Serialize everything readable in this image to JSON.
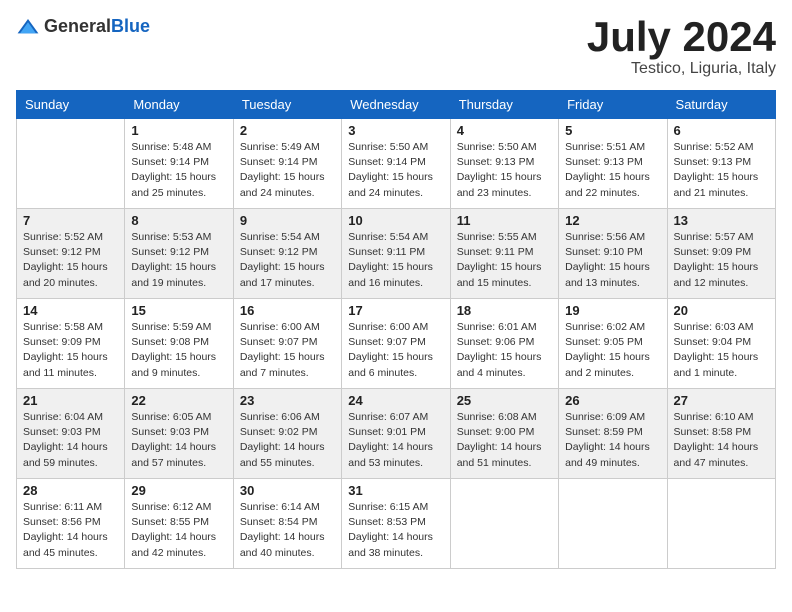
{
  "header": {
    "logo_general": "General",
    "logo_blue": "Blue",
    "month": "July 2024",
    "location": "Testico, Liguria, Italy"
  },
  "weekdays": [
    "Sunday",
    "Monday",
    "Tuesday",
    "Wednesday",
    "Thursday",
    "Friday",
    "Saturday"
  ],
  "weeks": [
    [
      {
        "day": "",
        "sunrise": "",
        "sunset": "",
        "daylight": ""
      },
      {
        "day": "1",
        "sunrise": "Sunrise: 5:48 AM",
        "sunset": "Sunset: 9:14 PM",
        "daylight": "Daylight: 15 hours and 25 minutes."
      },
      {
        "day": "2",
        "sunrise": "Sunrise: 5:49 AM",
        "sunset": "Sunset: 9:14 PM",
        "daylight": "Daylight: 15 hours and 24 minutes."
      },
      {
        "day": "3",
        "sunrise": "Sunrise: 5:50 AM",
        "sunset": "Sunset: 9:14 PM",
        "daylight": "Daylight: 15 hours and 24 minutes."
      },
      {
        "day": "4",
        "sunrise": "Sunrise: 5:50 AM",
        "sunset": "Sunset: 9:13 PM",
        "daylight": "Daylight: 15 hours and 23 minutes."
      },
      {
        "day": "5",
        "sunrise": "Sunrise: 5:51 AM",
        "sunset": "Sunset: 9:13 PM",
        "daylight": "Daylight: 15 hours and 22 minutes."
      },
      {
        "day": "6",
        "sunrise": "Sunrise: 5:52 AM",
        "sunset": "Sunset: 9:13 PM",
        "daylight": "Daylight: 15 hours and 21 minutes."
      }
    ],
    [
      {
        "day": "7",
        "sunrise": "Sunrise: 5:52 AM",
        "sunset": "Sunset: 9:12 PM",
        "daylight": "Daylight: 15 hours and 20 minutes."
      },
      {
        "day": "8",
        "sunrise": "Sunrise: 5:53 AM",
        "sunset": "Sunset: 9:12 PM",
        "daylight": "Daylight: 15 hours and 19 minutes."
      },
      {
        "day": "9",
        "sunrise": "Sunrise: 5:54 AM",
        "sunset": "Sunset: 9:12 PM",
        "daylight": "Daylight: 15 hours and 17 minutes."
      },
      {
        "day": "10",
        "sunrise": "Sunrise: 5:54 AM",
        "sunset": "Sunset: 9:11 PM",
        "daylight": "Daylight: 15 hours and 16 minutes."
      },
      {
        "day": "11",
        "sunrise": "Sunrise: 5:55 AM",
        "sunset": "Sunset: 9:11 PM",
        "daylight": "Daylight: 15 hours and 15 minutes."
      },
      {
        "day": "12",
        "sunrise": "Sunrise: 5:56 AM",
        "sunset": "Sunset: 9:10 PM",
        "daylight": "Daylight: 15 hours and 13 minutes."
      },
      {
        "day": "13",
        "sunrise": "Sunrise: 5:57 AM",
        "sunset": "Sunset: 9:09 PM",
        "daylight": "Daylight: 15 hours and 12 minutes."
      }
    ],
    [
      {
        "day": "14",
        "sunrise": "Sunrise: 5:58 AM",
        "sunset": "Sunset: 9:09 PM",
        "daylight": "Daylight: 15 hours and 11 minutes."
      },
      {
        "day": "15",
        "sunrise": "Sunrise: 5:59 AM",
        "sunset": "Sunset: 9:08 PM",
        "daylight": "Daylight: 15 hours and 9 minutes."
      },
      {
        "day": "16",
        "sunrise": "Sunrise: 6:00 AM",
        "sunset": "Sunset: 9:07 PM",
        "daylight": "Daylight: 15 hours and 7 minutes."
      },
      {
        "day": "17",
        "sunrise": "Sunrise: 6:00 AM",
        "sunset": "Sunset: 9:07 PM",
        "daylight": "Daylight: 15 hours and 6 minutes."
      },
      {
        "day": "18",
        "sunrise": "Sunrise: 6:01 AM",
        "sunset": "Sunset: 9:06 PM",
        "daylight": "Daylight: 15 hours and 4 minutes."
      },
      {
        "day": "19",
        "sunrise": "Sunrise: 6:02 AM",
        "sunset": "Sunset: 9:05 PM",
        "daylight": "Daylight: 15 hours and 2 minutes."
      },
      {
        "day": "20",
        "sunrise": "Sunrise: 6:03 AM",
        "sunset": "Sunset: 9:04 PM",
        "daylight": "Daylight: 15 hours and 1 minute."
      }
    ],
    [
      {
        "day": "21",
        "sunrise": "Sunrise: 6:04 AM",
        "sunset": "Sunset: 9:03 PM",
        "daylight": "Daylight: 14 hours and 59 minutes."
      },
      {
        "day": "22",
        "sunrise": "Sunrise: 6:05 AM",
        "sunset": "Sunset: 9:03 PM",
        "daylight": "Daylight: 14 hours and 57 minutes."
      },
      {
        "day": "23",
        "sunrise": "Sunrise: 6:06 AM",
        "sunset": "Sunset: 9:02 PM",
        "daylight": "Daylight: 14 hours and 55 minutes."
      },
      {
        "day": "24",
        "sunrise": "Sunrise: 6:07 AM",
        "sunset": "Sunset: 9:01 PM",
        "daylight": "Daylight: 14 hours and 53 minutes."
      },
      {
        "day": "25",
        "sunrise": "Sunrise: 6:08 AM",
        "sunset": "Sunset: 9:00 PM",
        "daylight": "Daylight: 14 hours and 51 minutes."
      },
      {
        "day": "26",
        "sunrise": "Sunrise: 6:09 AM",
        "sunset": "Sunset: 8:59 PM",
        "daylight": "Daylight: 14 hours and 49 minutes."
      },
      {
        "day": "27",
        "sunrise": "Sunrise: 6:10 AM",
        "sunset": "Sunset: 8:58 PM",
        "daylight": "Daylight: 14 hours and 47 minutes."
      }
    ],
    [
      {
        "day": "28",
        "sunrise": "Sunrise: 6:11 AM",
        "sunset": "Sunset: 8:56 PM",
        "daylight": "Daylight: 14 hours and 45 minutes."
      },
      {
        "day": "29",
        "sunrise": "Sunrise: 6:12 AM",
        "sunset": "Sunset: 8:55 PM",
        "daylight": "Daylight: 14 hours and 42 minutes."
      },
      {
        "day": "30",
        "sunrise": "Sunrise: 6:14 AM",
        "sunset": "Sunset: 8:54 PM",
        "daylight": "Daylight: 14 hours and 40 minutes."
      },
      {
        "day": "31",
        "sunrise": "Sunrise: 6:15 AM",
        "sunset": "Sunset: 8:53 PM",
        "daylight": "Daylight: 14 hours and 38 minutes."
      },
      {
        "day": "",
        "sunrise": "",
        "sunset": "",
        "daylight": ""
      },
      {
        "day": "",
        "sunrise": "",
        "sunset": "",
        "daylight": ""
      },
      {
        "day": "",
        "sunrise": "",
        "sunset": "",
        "daylight": ""
      }
    ]
  ]
}
